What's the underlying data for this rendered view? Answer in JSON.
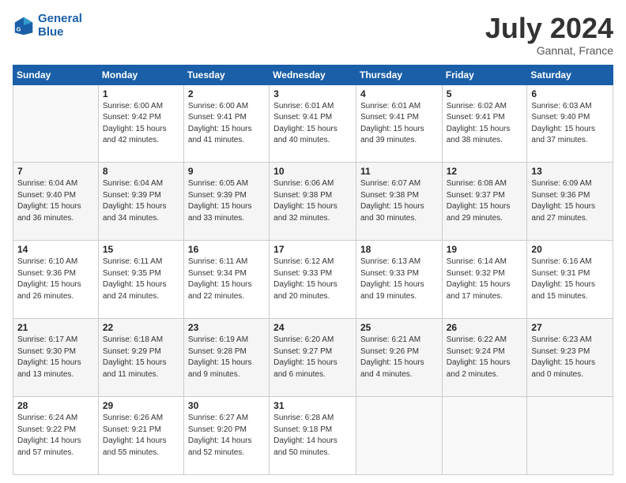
{
  "header": {
    "logo_line1": "General",
    "logo_line2": "Blue",
    "month": "July 2024",
    "location": "Gannat, France"
  },
  "weekdays": [
    "Sunday",
    "Monday",
    "Tuesday",
    "Wednesday",
    "Thursday",
    "Friday",
    "Saturday"
  ],
  "weeks": [
    [
      {
        "day": "",
        "info": ""
      },
      {
        "day": "1",
        "info": "Sunrise: 6:00 AM\nSunset: 9:42 PM\nDaylight: 15 hours\nand 42 minutes."
      },
      {
        "day": "2",
        "info": "Sunrise: 6:00 AM\nSunset: 9:41 PM\nDaylight: 15 hours\nand 41 minutes."
      },
      {
        "day": "3",
        "info": "Sunrise: 6:01 AM\nSunset: 9:41 PM\nDaylight: 15 hours\nand 40 minutes."
      },
      {
        "day": "4",
        "info": "Sunrise: 6:01 AM\nSunset: 9:41 PM\nDaylight: 15 hours\nand 39 minutes."
      },
      {
        "day": "5",
        "info": "Sunrise: 6:02 AM\nSunset: 9:41 PM\nDaylight: 15 hours\nand 38 minutes."
      },
      {
        "day": "6",
        "info": "Sunrise: 6:03 AM\nSunset: 9:40 PM\nDaylight: 15 hours\nand 37 minutes."
      }
    ],
    [
      {
        "day": "7",
        "info": "Sunrise: 6:04 AM\nSunset: 9:40 PM\nDaylight: 15 hours\nand 36 minutes."
      },
      {
        "day": "8",
        "info": "Sunrise: 6:04 AM\nSunset: 9:39 PM\nDaylight: 15 hours\nand 34 minutes."
      },
      {
        "day": "9",
        "info": "Sunrise: 6:05 AM\nSunset: 9:39 PM\nDaylight: 15 hours\nand 33 minutes."
      },
      {
        "day": "10",
        "info": "Sunrise: 6:06 AM\nSunset: 9:38 PM\nDaylight: 15 hours\nand 32 minutes."
      },
      {
        "day": "11",
        "info": "Sunrise: 6:07 AM\nSunset: 9:38 PM\nDaylight: 15 hours\nand 30 minutes."
      },
      {
        "day": "12",
        "info": "Sunrise: 6:08 AM\nSunset: 9:37 PM\nDaylight: 15 hours\nand 29 minutes."
      },
      {
        "day": "13",
        "info": "Sunrise: 6:09 AM\nSunset: 9:36 PM\nDaylight: 15 hours\nand 27 minutes."
      }
    ],
    [
      {
        "day": "14",
        "info": "Sunrise: 6:10 AM\nSunset: 9:36 PM\nDaylight: 15 hours\nand 26 minutes."
      },
      {
        "day": "15",
        "info": "Sunrise: 6:11 AM\nSunset: 9:35 PM\nDaylight: 15 hours\nand 24 minutes."
      },
      {
        "day": "16",
        "info": "Sunrise: 6:11 AM\nSunset: 9:34 PM\nDaylight: 15 hours\nand 22 minutes."
      },
      {
        "day": "17",
        "info": "Sunrise: 6:12 AM\nSunset: 9:33 PM\nDaylight: 15 hours\nand 20 minutes."
      },
      {
        "day": "18",
        "info": "Sunrise: 6:13 AM\nSunset: 9:33 PM\nDaylight: 15 hours\nand 19 minutes."
      },
      {
        "day": "19",
        "info": "Sunrise: 6:14 AM\nSunset: 9:32 PM\nDaylight: 15 hours\nand 17 minutes."
      },
      {
        "day": "20",
        "info": "Sunrise: 6:16 AM\nSunset: 9:31 PM\nDaylight: 15 hours\nand 15 minutes."
      }
    ],
    [
      {
        "day": "21",
        "info": "Sunrise: 6:17 AM\nSunset: 9:30 PM\nDaylight: 15 hours\nand 13 minutes."
      },
      {
        "day": "22",
        "info": "Sunrise: 6:18 AM\nSunset: 9:29 PM\nDaylight: 15 hours\nand 11 minutes."
      },
      {
        "day": "23",
        "info": "Sunrise: 6:19 AM\nSunset: 9:28 PM\nDaylight: 15 hours\nand 9 minutes."
      },
      {
        "day": "24",
        "info": "Sunrise: 6:20 AM\nSunset: 9:27 PM\nDaylight: 15 hours\nand 6 minutes."
      },
      {
        "day": "25",
        "info": "Sunrise: 6:21 AM\nSunset: 9:26 PM\nDaylight: 15 hours\nand 4 minutes."
      },
      {
        "day": "26",
        "info": "Sunrise: 6:22 AM\nSunset: 9:24 PM\nDaylight: 15 hours\nand 2 minutes."
      },
      {
        "day": "27",
        "info": "Sunrise: 6:23 AM\nSunset: 9:23 PM\nDaylight: 15 hours\nand 0 minutes."
      }
    ],
    [
      {
        "day": "28",
        "info": "Sunrise: 6:24 AM\nSunset: 9:22 PM\nDaylight: 14 hours\nand 57 minutes."
      },
      {
        "day": "29",
        "info": "Sunrise: 6:26 AM\nSunset: 9:21 PM\nDaylight: 14 hours\nand 55 minutes."
      },
      {
        "day": "30",
        "info": "Sunrise: 6:27 AM\nSunset: 9:20 PM\nDaylight: 14 hours\nand 52 minutes."
      },
      {
        "day": "31",
        "info": "Sunrise: 6:28 AM\nSunset: 9:18 PM\nDaylight: 14 hours\nand 50 minutes."
      },
      {
        "day": "",
        "info": ""
      },
      {
        "day": "",
        "info": ""
      },
      {
        "day": "",
        "info": ""
      }
    ]
  ]
}
